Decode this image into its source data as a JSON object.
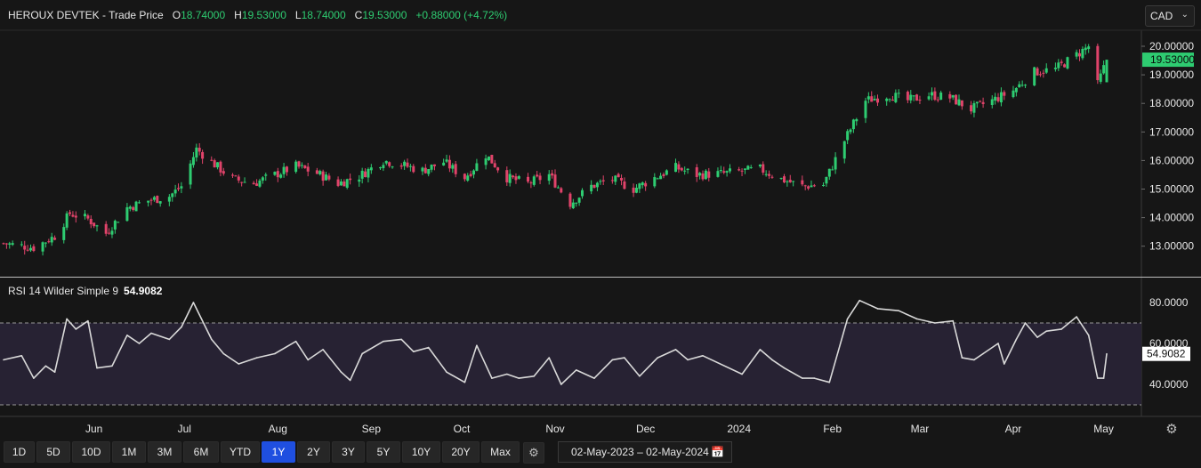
{
  "header": {
    "title": "HEROUX DEVTEK - Trade Price",
    "o_label": "O",
    "o_value": "18.74000",
    "h_label": "H",
    "h_value": "19.53000",
    "l_label": "L",
    "l_value": "18.74000",
    "c_label": "C",
    "c_value": "19.53000",
    "change": "+0.88000 (+4.72%)"
  },
  "currency": {
    "selected": "CAD",
    "chevron_icon": "chevron-down-icon"
  },
  "rsi_header": {
    "label": "RSI 14 Wilder Simple 9",
    "value": "54.9082"
  },
  "range_buttons": [
    "1D",
    "5D",
    "10D",
    "1M",
    "3M",
    "6M",
    "YTD",
    "1Y",
    "2Y",
    "3Y",
    "5Y",
    "10Y",
    "20Y",
    "Max"
  ],
  "active_range": "1Y",
  "date_range": {
    "from": "02-May-2023",
    "separator": "–",
    "to": "02-May-2024"
  },
  "icons": {
    "settings": "gear-icon",
    "range_settings": "settings-cog-icon",
    "calendar": "calendar-icon"
  },
  "colors": {
    "up": "#2ecc71",
    "down": "#e0436a",
    "rsi_line": "#d9d9d9",
    "rsi_band": "#272233",
    "active": "#1f4fe0"
  },
  "chart_data": [
    {
      "type": "candlestick",
      "title": "HEROUX DEVTEK - Trade Price",
      "x_tick_labels": [
        "Jun",
        "Jul",
        "Aug",
        "Sep",
        "Oct",
        "Nov",
        "Dec",
        "2024",
        "Feb",
        "Mar",
        "Apr",
        "May"
      ],
      "y_tick_labels": [
        "13.00000",
        "14.00000",
        "15.00000",
        "16.00000",
        "17.00000",
        "18.00000",
        "19.00000",
        "20.00000"
      ],
      "ylim": [
        12.2,
        20.6
      ],
      "last_price_label": "19.53000",
      "close_path": [
        {
          "date": "2023-05-02",
          "close": 13.1
        },
        {
          "date": "2023-05-12",
          "close": 12.95
        },
        {
          "date": "2023-05-19",
          "close": 13.35
        },
        {
          "date": "2023-05-24",
          "close": 14.15
        },
        {
          "date": "2023-05-30",
          "close": 13.95
        },
        {
          "date": "2023-06-05",
          "close": 13.45
        },
        {
          "date": "2023-06-12",
          "close": 14.35
        },
        {
          "date": "2023-06-19",
          "close": 14.6
        },
        {
          "date": "2023-06-26",
          "close": 14.75
        },
        {
          "date": "2023-06-30",
          "close": 15.1
        },
        {
          "date": "2023-07-05",
          "close": 16.4
        },
        {
          "date": "2023-07-10",
          "close": 15.95
        },
        {
          "date": "2023-07-17",
          "close": 15.35
        },
        {
          "date": "2023-07-24",
          "close": 15.2
        },
        {
          "date": "2023-07-31",
          "close": 15.5
        },
        {
          "date": "2023-08-07",
          "close": 15.8
        },
        {
          "date": "2023-08-14",
          "close": 15.55
        },
        {
          "date": "2023-08-21",
          "close": 15.2
        },
        {
          "date": "2023-08-28",
          "close": 15.45
        },
        {
          "date": "2023-09-05",
          "close": 16.0
        },
        {
          "date": "2023-09-11",
          "close": 15.85
        },
        {
          "date": "2023-09-18",
          "close": 15.65
        },
        {
          "date": "2023-09-25",
          "close": 15.95
        },
        {
          "date": "2023-10-02",
          "close": 15.4
        },
        {
          "date": "2023-10-09",
          "close": 16.2
        },
        {
          "date": "2023-10-16",
          "close": 15.4
        },
        {
          "date": "2023-10-23",
          "close": 15.2
        },
        {
          "date": "2023-10-30",
          "close": 15.5
        },
        {
          "date": "2023-11-06",
          "close": 14.5
        },
        {
          "date": "2023-11-13",
          "close": 15.1
        },
        {
          "date": "2023-11-20",
          "close": 15.35
        },
        {
          "date": "2023-11-27",
          "close": 15.0
        },
        {
          "date": "2023-12-04",
          "close": 15.4
        },
        {
          "date": "2023-12-11",
          "close": 15.75
        },
        {
          "date": "2023-12-18",
          "close": 15.5
        },
        {
          "date": "2023-12-27",
          "close": 15.55
        },
        {
          "date": "2024-01-08",
          "close": 15.7
        },
        {
          "date": "2024-01-15",
          "close": 15.35
        },
        {
          "date": "2024-01-22",
          "close": 15.1
        },
        {
          "date": "2024-01-29",
          "close": 15.15
        },
        {
          "date": "2024-02-05",
          "close": 16.7
        },
        {
          "date": "2024-02-12",
          "close": 18.1
        },
        {
          "date": "2024-02-20",
          "close": 18.3
        },
        {
          "date": "2024-02-26",
          "close": 18.1
        },
        {
          "date": "2024-03-04",
          "close": 18.3
        },
        {
          "date": "2024-03-11",
          "close": 18.2
        },
        {
          "date": "2024-03-18",
          "close": 17.8
        },
        {
          "date": "2024-03-25",
          "close": 18.1
        },
        {
          "date": "2024-04-01",
          "close": 18.45
        },
        {
          "date": "2024-04-08",
          "close": 19.1
        },
        {
          "date": "2024-04-15",
          "close": 19.2
        },
        {
          "date": "2024-04-22",
          "close": 19.7
        },
        {
          "date": "2024-04-26",
          "close": 20.0
        },
        {
          "date": "2024-04-29",
          "close": 18.65
        },
        {
          "date": "2024-05-02",
          "close": 19.53
        }
      ]
    },
    {
      "type": "line",
      "title": "RSI 14 Wilder Simple 9",
      "y_tick_labels": [
        "40.0000",
        "60.0000",
        "80.0000"
      ],
      "ylim": [
        20,
        84
      ],
      "bands": [
        30,
        70
      ],
      "last_value_label": "54.9082",
      "series": [
        {
          "values": [
            {
              "date": "2023-05-02",
              "y": 52
            },
            {
              "date": "2023-05-08",
              "y": 54
            },
            {
              "date": "2023-05-12",
              "y": 43
            },
            {
              "date": "2023-05-16",
              "y": 49
            },
            {
              "date": "2023-05-19",
              "y": 46
            },
            {
              "date": "2023-05-23",
              "y": 72
            },
            {
              "date": "2023-05-26",
              "y": 67
            },
            {
              "date": "2023-05-30",
              "y": 71
            },
            {
              "date": "2023-06-02",
              "y": 48
            },
            {
              "date": "2023-06-07",
              "y": 49
            },
            {
              "date": "2023-06-12",
              "y": 64
            },
            {
              "date": "2023-06-16",
              "y": 60
            },
            {
              "date": "2023-06-20",
              "y": 65
            },
            {
              "date": "2023-06-26",
              "y": 62
            },
            {
              "date": "2023-06-30",
              "y": 68
            },
            {
              "date": "2023-07-04",
              "y": 80
            },
            {
              "date": "2023-07-10",
              "y": 62
            },
            {
              "date": "2023-07-14",
              "y": 55
            },
            {
              "date": "2023-07-19",
              "y": 50
            },
            {
              "date": "2023-07-25",
              "y": 53
            },
            {
              "date": "2023-07-31",
              "y": 55
            },
            {
              "date": "2023-08-07",
              "y": 61
            },
            {
              "date": "2023-08-11",
              "y": 52
            },
            {
              "date": "2023-08-16",
              "y": 57
            },
            {
              "date": "2023-08-22",
              "y": 46
            },
            {
              "date": "2023-08-25",
              "y": 42
            },
            {
              "date": "2023-08-29",
              "y": 55
            },
            {
              "date": "2023-09-05",
              "y": 61
            },
            {
              "date": "2023-09-11",
              "y": 62
            },
            {
              "date": "2023-09-15",
              "y": 56
            },
            {
              "date": "2023-09-20",
              "y": 58
            },
            {
              "date": "2023-09-26",
              "y": 46
            },
            {
              "date": "2023-10-02",
              "y": 41
            },
            {
              "date": "2023-10-06",
              "y": 59
            },
            {
              "date": "2023-10-11",
              "y": 43
            },
            {
              "date": "2023-10-16",
              "y": 45
            },
            {
              "date": "2023-10-20",
              "y": 43
            },
            {
              "date": "2023-10-25",
              "y": 44
            },
            {
              "date": "2023-10-30",
              "y": 53
            },
            {
              "date": "2023-11-03",
              "y": 40
            },
            {
              "date": "2023-11-08",
              "y": 47
            },
            {
              "date": "2023-11-14",
              "y": 43
            },
            {
              "date": "2023-11-20",
              "y": 52
            },
            {
              "date": "2023-11-24",
              "y": 53
            },
            {
              "date": "2023-11-29",
              "y": 44
            },
            {
              "date": "2023-12-05",
              "y": 53
            },
            {
              "date": "2023-12-11",
              "y": 57
            },
            {
              "date": "2023-12-15",
              "y": 52
            },
            {
              "date": "2023-12-20",
              "y": 54
            },
            {
              "date": "2024-01-02",
              "y": 45
            },
            {
              "date": "2024-01-08",
              "y": 57
            },
            {
              "date": "2024-01-12",
              "y": 52
            },
            {
              "date": "2024-01-16",
              "y": 48
            },
            {
              "date": "2024-01-22",
              "y": 43
            },
            {
              "date": "2024-01-26",
              "y": 43
            },
            {
              "date": "2024-01-31",
              "y": 41
            },
            {
              "date": "2024-02-06",
              "y": 72
            },
            {
              "date": "2024-02-10",
              "y": 81
            },
            {
              "date": "2024-02-16",
              "y": 77
            },
            {
              "date": "2024-02-23",
              "y": 76
            },
            {
              "date": "2024-02-29",
              "y": 72
            },
            {
              "date": "2024-03-06",
              "y": 70
            },
            {
              "date": "2024-03-12",
              "y": 71
            },
            {
              "date": "2024-03-15",
              "y": 53
            },
            {
              "date": "2024-03-19",
              "y": 52
            },
            {
              "date": "2024-03-22",
              "y": 55
            },
            {
              "date": "2024-03-27",
              "y": 60
            },
            {
              "date": "2024-03-29",
              "y": 50
            },
            {
              "date": "2024-04-02",
              "y": 62
            },
            {
              "date": "2024-04-05",
              "y": 70
            },
            {
              "date": "2024-04-09",
              "y": 63
            },
            {
              "date": "2024-04-12",
              "y": 66
            },
            {
              "date": "2024-04-17",
              "y": 67
            },
            {
              "date": "2024-04-22",
              "y": 73
            },
            {
              "date": "2024-04-26",
              "y": 64
            },
            {
              "date": "2024-04-29",
              "y": 43
            },
            {
              "date": "2024-05-01",
              "y": 43
            },
            {
              "date": "2024-05-02",
              "y": 54.9082
            }
          ]
        }
      ]
    }
  ]
}
